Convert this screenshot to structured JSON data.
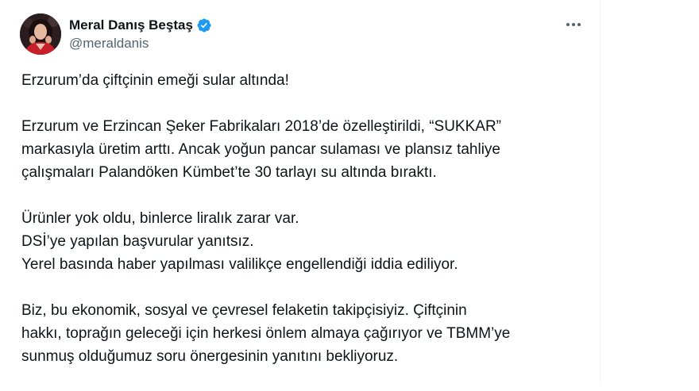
{
  "author": {
    "display_name": "Meral Danış Beştaş",
    "handle": "@meraldanis",
    "verified": true,
    "verified_color": "#1d9bf0"
  },
  "menu": {
    "icon": "more-horizontal-icon"
  },
  "tweet": {
    "paragraphs": [
      {
        "lines": [
          "Erzurum’da çiftçinin emeği sular altında!"
        ]
      },
      {
        "lines": [
          "Erzurum ve Erzincan Şeker Fabrikaları 2018’de özelleştirildi, “SUKKAR”",
          "markasıyla üretim arttı. Ancak yoğun pancar sulaması ve plansız tahliye",
          "çalışmaları Palandöken Kümbet’te 30 tarlayı su altında bıraktı."
        ]
      },
      {
        "lines": [
          "Ürünler yok oldu, binlerce liralık zarar var.",
          "DSİ’ye yapılan başvurular yanıtsız.",
          "Yerel basında haber yapılması valilikçe engellendiği iddia ediliyor."
        ]
      },
      {
        "lines": [
          "Biz, bu ekonomik, sosyal ve çevresel felaketin takipçisiyiz. Çiftçinin",
          "hakkı, toprağın geleceği için herkesi önlem almaya çağırıyor ve TBMM’ye",
          "sunmuş olduğumuz soru önergesinin yanıtını bekliyoruz."
        ]
      }
    ]
  }
}
